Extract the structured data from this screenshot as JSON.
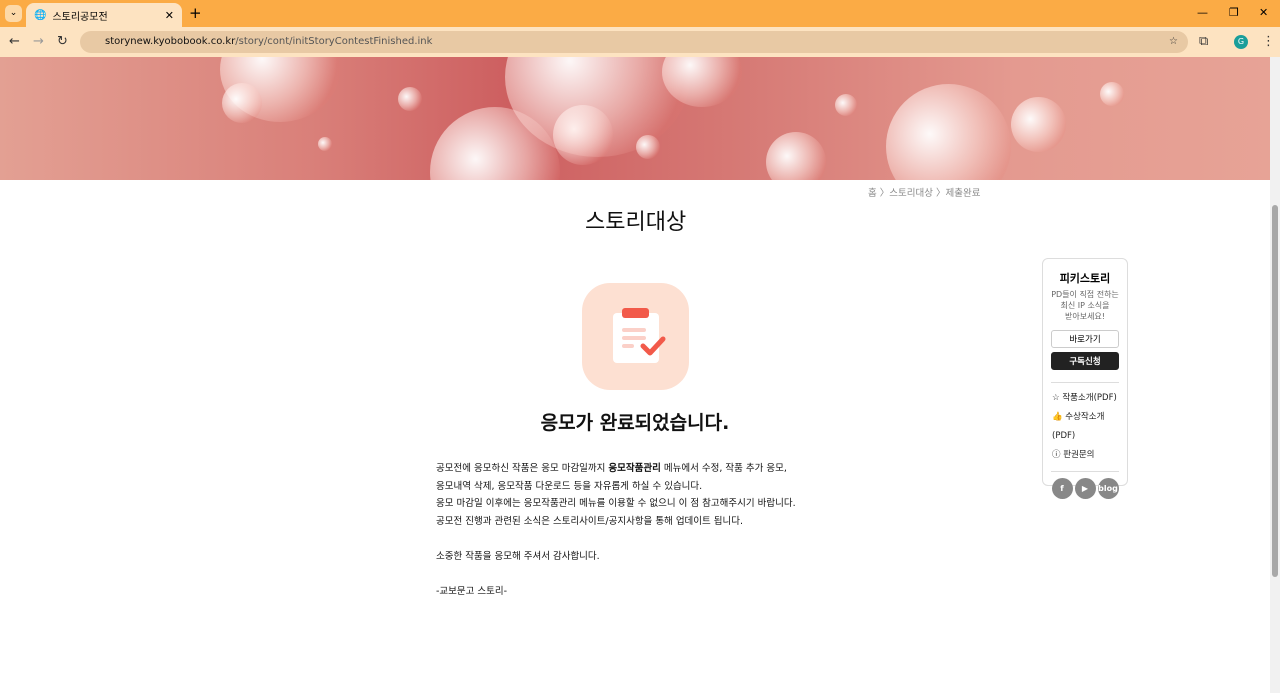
{
  "browser": {
    "tab_title": "스토리공모전",
    "url_host": "storynew.kyobobook.co.kr",
    "url_path": "/story/cont/initStoryContestFinished.ink",
    "profile_initial": "G"
  },
  "breadcrumb": "홈 〉스토리대상 〉제출완료",
  "page_title": "스토리대상",
  "heading": "응모가 완료되었습니다.",
  "body": {
    "line1_a": "공모전에 응모하신 작품은 응모 마감일까지 ",
    "line1_bold": "응모작품관리",
    "line1_b": " 메뉴에서 수정, 작품 추가 응모,",
    "line2": "응모내역 삭제, 응모작품 다운로드 등을 자유롭게 하실 수 있습니다.",
    "line3": "응모 마감일 이후에는 응모작품관리 메뉴를 이용할 수 없으니 이 점 참고해주시기 바랍니다.",
    "line4": "공모전 진행과 관련된 소식은 스토리사이트/공지사항을 통해 업데이트 됩니다.",
    "thanks": "소중한 작품을 응모해 주셔서 감사합니다.",
    "sign": "-교보문고 스토리-"
  },
  "sidebar": {
    "title": "피키스토리",
    "desc1": "PD들이 직접 전하는",
    "desc2": "최신 IP 소식을",
    "desc3": "받아보세요!",
    "go": "바로가기",
    "subscribe": "구독신청",
    "links": [
      "작품소개(PDF)",
      "수상작소개(PDF)",
      "판권문의"
    ],
    "social": [
      "f",
      "▶",
      "blog"
    ]
  },
  "colors": {
    "tabbar": "#fbab45",
    "accent": "#f25a4a",
    "icon_bg": "#fde0d2"
  }
}
